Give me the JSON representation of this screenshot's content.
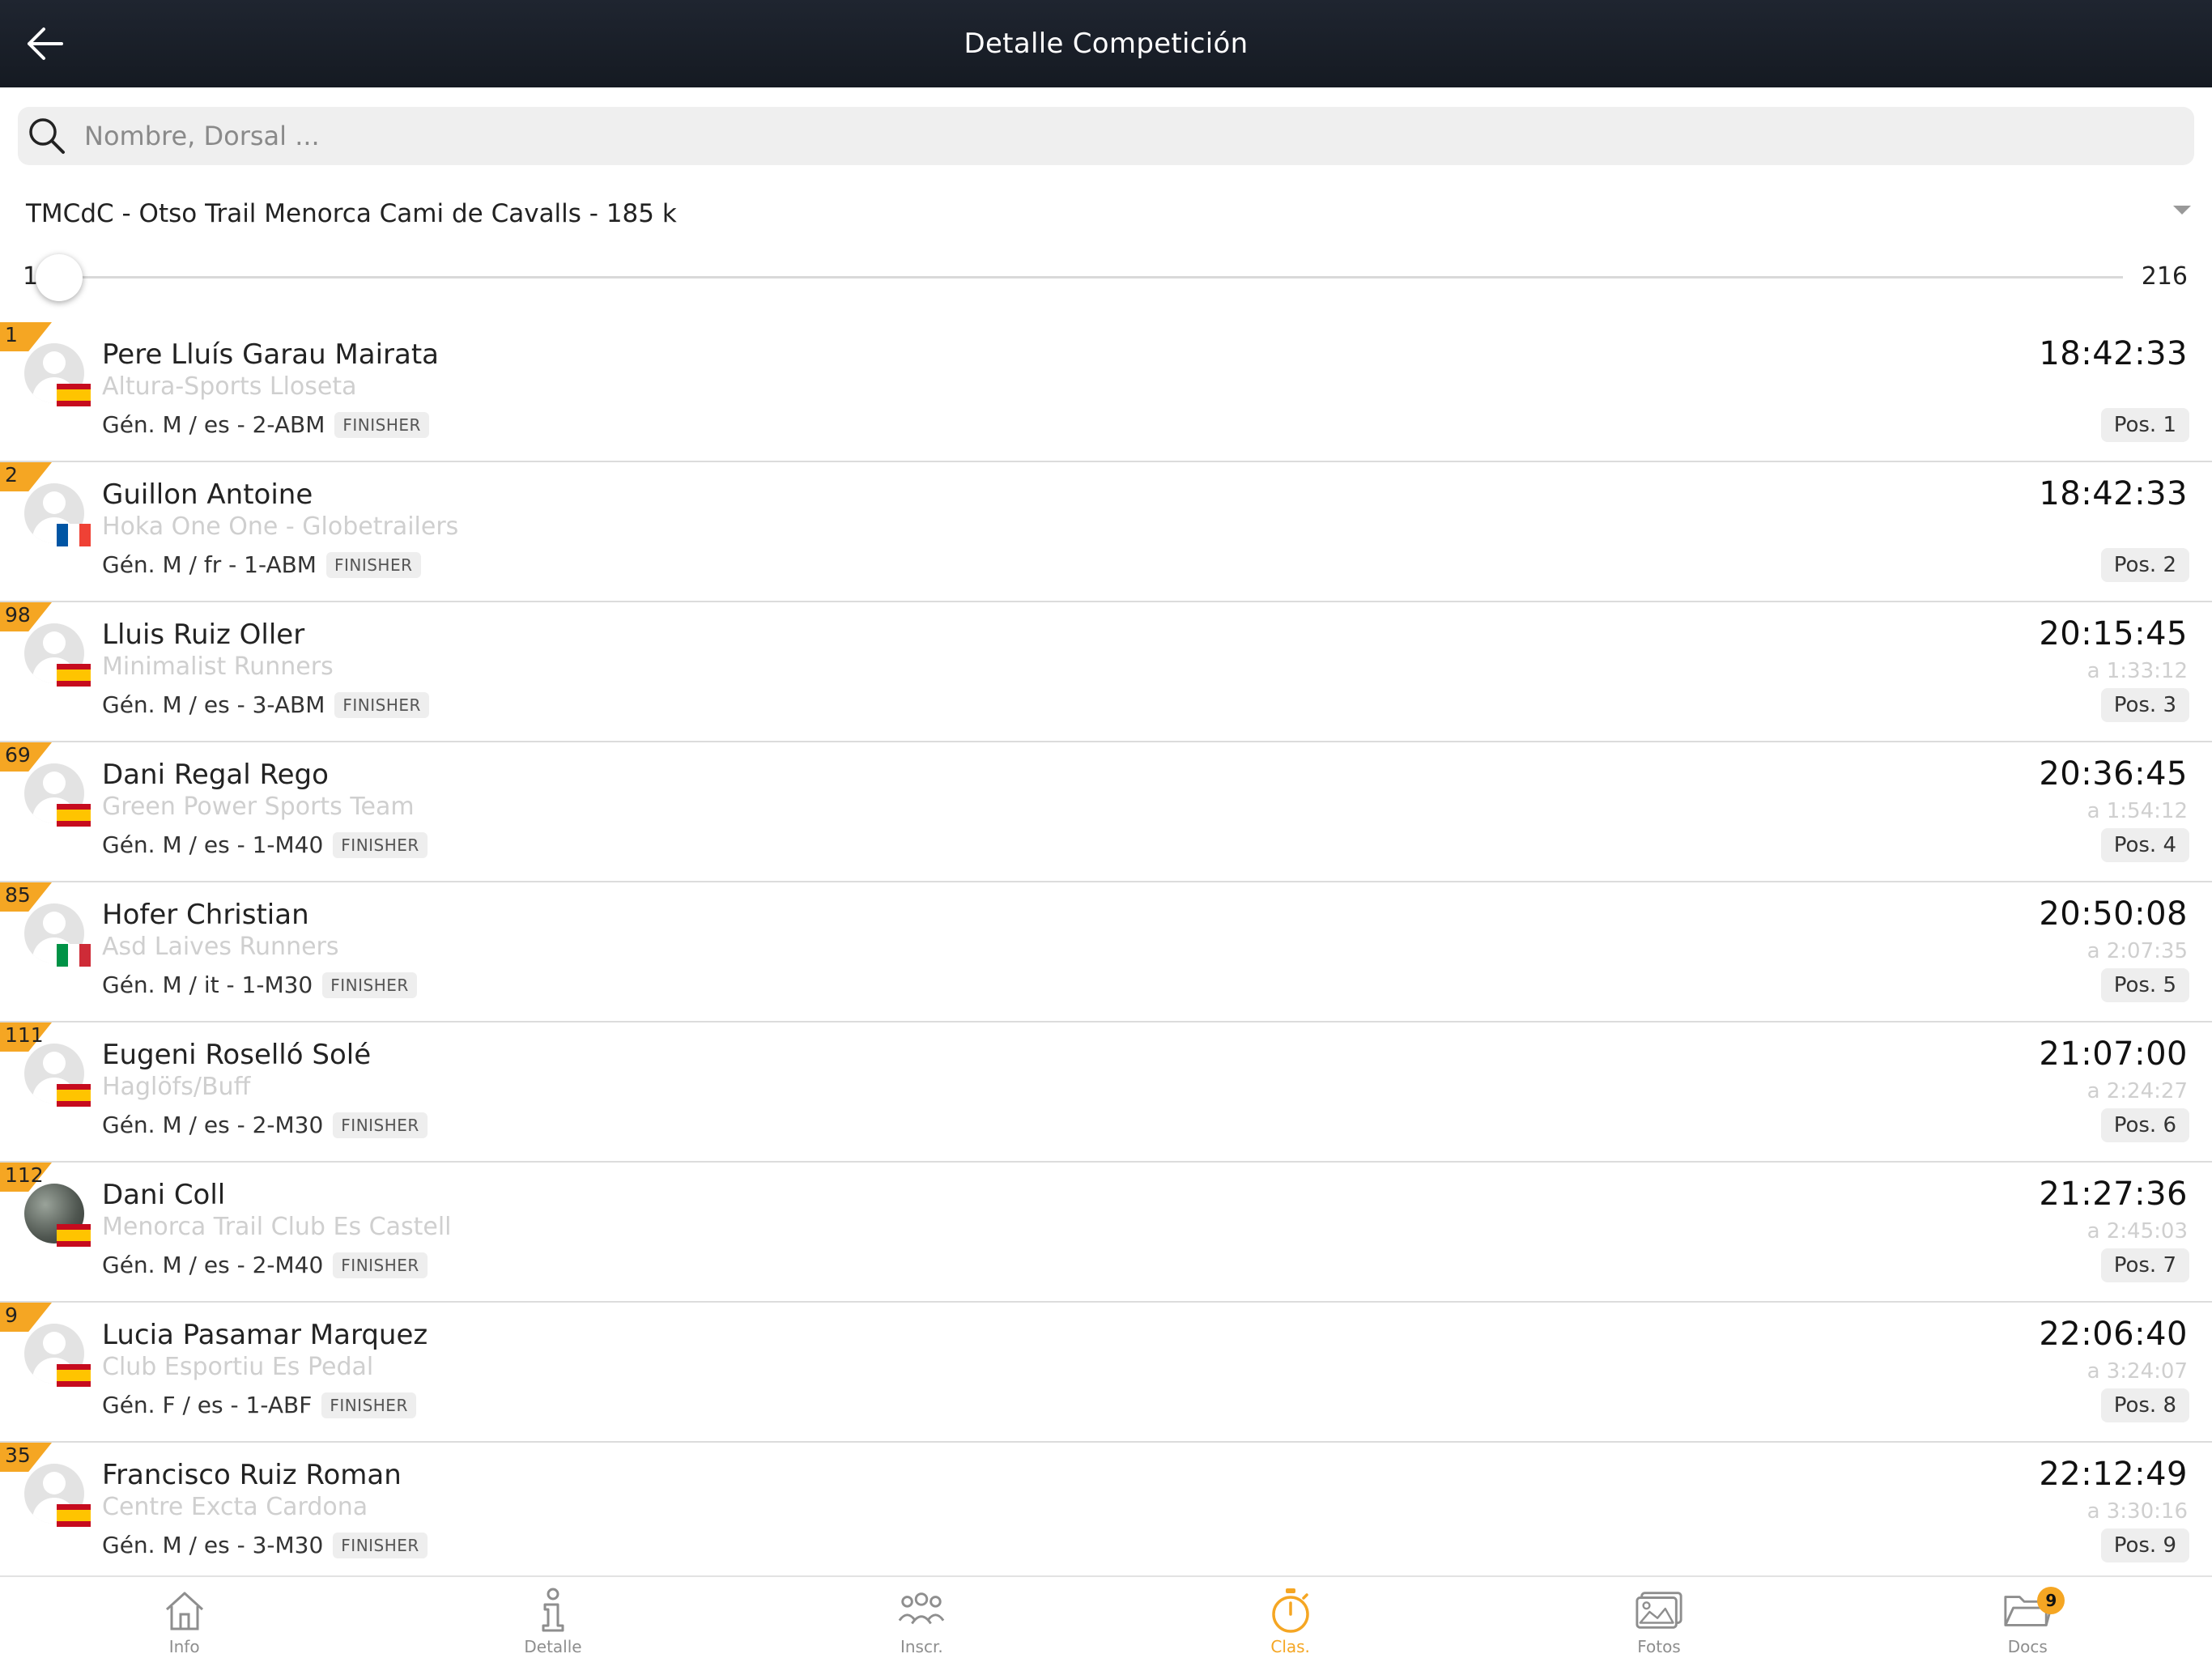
{
  "header": {
    "title": "Detalle Competición"
  },
  "search": {
    "placeholder": "Nombre, Dorsal ..."
  },
  "competition": {
    "selected": "TMCdC - Otso Trail Menorca Cami de Cavalls - 185 k"
  },
  "range": {
    "min": "1",
    "max": "216",
    "current": "1"
  },
  "colors": {
    "accent": "#f5a623",
    "header_bg": "#1a1f28"
  },
  "results": [
    {
      "bib": "1",
      "name": "Pere Lluís Garau Mairata",
      "club": "Altura-Sports Lloseta",
      "info": "Gén. M / es - 2-ABM",
      "status": "FINISHER",
      "time": "18:42:33",
      "gap": "",
      "pos": "Pos. 1",
      "flag": "es",
      "photo": false
    },
    {
      "bib": "2",
      "name": "Guillon Antoine",
      "club": "Hoka One One - Globetrailers",
      "info": "Gén. M / fr - 1-ABM",
      "status": "FINISHER",
      "time": "18:42:33",
      "gap": "",
      "pos": "Pos. 2",
      "flag": "fr",
      "photo": false
    },
    {
      "bib": "98",
      "name": "Lluis Ruiz Oller",
      "club": "Minimalist Runners",
      "info": "Gén. M / es - 3-ABM",
      "status": "FINISHER",
      "time": "20:15:45",
      "gap": "a 1:33:12",
      "pos": "Pos. 3",
      "flag": "es",
      "photo": false
    },
    {
      "bib": "69",
      "name": "Dani Regal Rego",
      "club": "Green Power Sports Team",
      "info": "Gén. M / es - 1-M40",
      "status": "FINISHER",
      "time": "20:36:45",
      "gap": "a 1:54:12",
      "pos": "Pos. 4",
      "flag": "es",
      "photo": false
    },
    {
      "bib": "85",
      "name": "Hofer Christian",
      "club": "Asd Laives Runners",
      "info": "Gén. M / it - 1-M30",
      "status": "FINISHER",
      "time": "20:50:08",
      "gap": "a 2:07:35",
      "pos": "Pos. 5",
      "flag": "it",
      "photo": false
    },
    {
      "bib": "111",
      "name": "Eugeni Roselló Solé",
      "club": "Haglöfs/Buff",
      "info": "Gén. M / es - 2-M30",
      "status": "FINISHER",
      "time": "21:07:00",
      "gap": "a 2:24:27",
      "pos": "Pos. 6",
      "flag": "es",
      "photo": false
    },
    {
      "bib": "112",
      "name": "Dani Coll",
      "club": "Menorca Trail Club Es Castell",
      "info": "Gén. M / es - 2-M40",
      "status": "FINISHER",
      "time": "21:27:36",
      "gap": "a 2:45:03",
      "pos": "Pos. 7",
      "flag": "es",
      "photo": true
    },
    {
      "bib": "9",
      "name": "Lucia Pasamar Marquez",
      "club": "Club Esportiu Es Pedal",
      "info": "Gén. F / es - 1-ABF",
      "status": "FINISHER",
      "time": "22:06:40",
      "gap": "a 3:24:07",
      "pos": "Pos. 8",
      "flag": "es",
      "photo": false
    },
    {
      "bib": "35",
      "name": "Francisco Ruiz Roman",
      "club": "Centre Excta Cardona",
      "info": "Gén. M / es - 3-M30",
      "status": "FINISHER",
      "time": "22:12:49",
      "gap": "a 3:30:16",
      "pos": "Pos. 9",
      "flag": "es",
      "photo": false
    }
  ],
  "tabs": [
    {
      "label": "Info",
      "icon": "home-icon",
      "active": false
    },
    {
      "label": "Detalle",
      "icon": "info-icon",
      "active": false
    },
    {
      "label": "Inscr.",
      "icon": "people-icon",
      "active": false
    },
    {
      "label": "Clas.",
      "icon": "stopwatch-icon",
      "active": true
    },
    {
      "label": "Fotos",
      "icon": "photos-icon",
      "active": false
    },
    {
      "label": "Docs",
      "icon": "folder-icon",
      "active": false,
      "badge": "9"
    }
  ]
}
